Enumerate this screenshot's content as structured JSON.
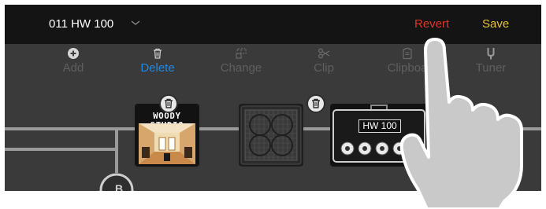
{
  "header": {
    "preset_name": "011 HW 100",
    "revert_label": "Revert",
    "save_label": "Save",
    "chevron_icon": "chevron-down-icon",
    "colors": {
      "bar": "#141414",
      "revert": "#e0342b",
      "save": "#e5c237"
    }
  },
  "toolbar": {
    "items": [
      {
        "label": "Add",
        "icon": "plus-circle-icon",
        "active": false
      },
      {
        "label": "Delete",
        "icon": "trash-icon",
        "active": true
      },
      {
        "label": "Change",
        "icon": "swap-icon",
        "active": false
      },
      {
        "label": "Clip",
        "icon": "scissors-icon",
        "active": false
      },
      {
        "label": "Clipboa",
        "icon": "clipboard-icon",
        "active": false
      },
      {
        "label": "Tuner",
        "icon": "tuning-fork-icon",
        "active": false
      }
    ],
    "colors": {
      "active": "#1e88e5",
      "inactive": "#5f5f5f"
    }
  },
  "signal_chain": {
    "blocks": [
      {
        "name": "WOODY STUDIO",
        "type": "room-reverb",
        "delete_badge": true
      },
      {
        "type": "speaker-cabinet",
        "delete_badge": true
      },
      {
        "name": "HW 100",
        "type": "amp-head",
        "delete_badge": false
      }
    ],
    "split_icon": "split-b-icon",
    "split_label": "B"
  }
}
